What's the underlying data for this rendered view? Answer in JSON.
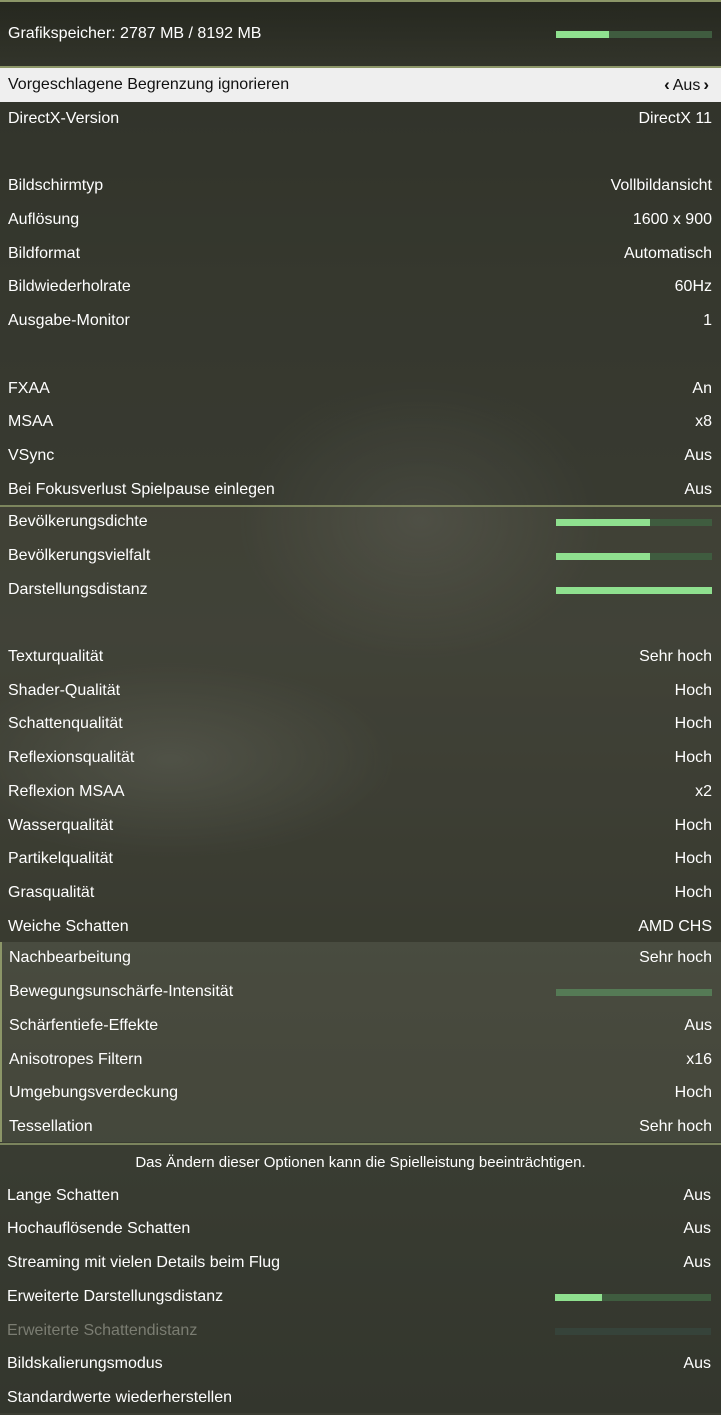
{
  "header": {
    "vram_label": "Grafikspeicher: 2787 MB / 8192 MB",
    "vram_fraction": 0.34
  },
  "settings": {
    "ignore_limit": {
      "label": "Vorgeschlagene Begrenzung ignorieren",
      "value": "Aus"
    },
    "directx": {
      "label": "DirectX-Version",
      "value": "DirectX 11"
    },
    "screen_type": {
      "label": "Bildschirmtyp",
      "value": "Vollbildansicht"
    },
    "resolution": {
      "label": "Auflösung",
      "value": "1600 x 900"
    },
    "aspect": {
      "label": "Bildformat",
      "value": "Automatisch"
    },
    "refresh": {
      "label": "Bildwiederholrate",
      "value": "60Hz"
    },
    "monitor": {
      "label": "Ausgabe-Monitor",
      "value": "1"
    },
    "fxaa": {
      "label": "FXAA",
      "value": "An"
    },
    "msaa": {
      "label": "MSAA",
      "value": "x8"
    },
    "vsync": {
      "label": "VSync",
      "value": "Aus"
    },
    "focus_pause": {
      "label": "Bei Fokusverlust Spielpause einlegen",
      "value": "Aus"
    },
    "pop_density": {
      "label": "Bevölkerungsdichte",
      "fraction": 0.6
    },
    "pop_variety": {
      "label": "Bevölkerungsvielfalt",
      "fraction": 0.6
    },
    "distance": {
      "label": "Darstellungsdistanz",
      "fraction": 1.0
    },
    "texture": {
      "label": "Texturqualität",
      "value": "Sehr hoch"
    },
    "shader": {
      "label": "Shader-Qualität",
      "value": "Hoch"
    },
    "shadow": {
      "label": "Schattenqualität",
      "value": "Hoch"
    },
    "reflection": {
      "label": "Reflexionsqualität",
      "value": "Hoch"
    },
    "reflection_msaa": {
      "label": "Reflexion MSAA",
      "value": "x2"
    },
    "water": {
      "label": "Wasserqualität",
      "value": "Hoch"
    },
    "particles": {
      "label": "Partikelqualität",
      "value": "Hoch"
    },
    "grass": {
      "label": "Grasqualität",
      "value": "Hoch"
    },
    "soft_shadows": {
      "label": "Weiche Schatten",
      "value": "AMD CHS"
    },
    "post_fx": {
      "label": "Nachbearbeitung",
      "value": "Sehr hoch"
    },
    "motion_blur": {
      "label": "Bewegungsunschärfe-Intensität",
      "fraction": 0.0
    },
    "dof": {
      "label": "Schärfentiefe-Effekte",
      "value": "Aus"
    },
    "aniso": {
      "label": "Anisotropes Filtern",
      "value": "x16"
    },
    "ao": {
      "label": "Umgebungsverdeckung",
      "value": "Hoch"
    },
    "tessellation": {
      "label": "Tessellation",
      "value": "Sehr hoch"
    }
  },
  "warning": "Das Ändern dieser Optionen kann die Spielleistung beeinträchtigen.",
  "advanced": {
    "long_shadows": {
      "label": "Lange Schatten",
      "value": "Aus"
    },
    "hires_shadows": {
      "label": "Hochauflösende Schatten",
      "value": "Aus"
    },
    "flight_streaming": {
      "label": "Streaming mit vielen Details beim Flug",
      "value": "Aus"
    },
    "ext_distance": {
      "label": "Erweiterte Darstellungsdistanz",
      "fraction": 0.3
    },
    "ext_shadow": {
      "label": "Erweiterte Schattendistanz",
      "fraction": 0.0
    },
    "scaling": {
      "label": "Bildskalierungsmodus",
      "value": "Aus"
    },
    "reset": {
      "label": "Standardwerte wiederherstellen"
    }
  },
  "icons": {
    "left": "chevron-left-icon",
    "right": "chevron-right-icon"
  },
  "colors": {
    "bar_fill": "#8fe08f",
    "bar_track": "#3f5c3f",
    "accent_line": "#8c9668"
  }
}
